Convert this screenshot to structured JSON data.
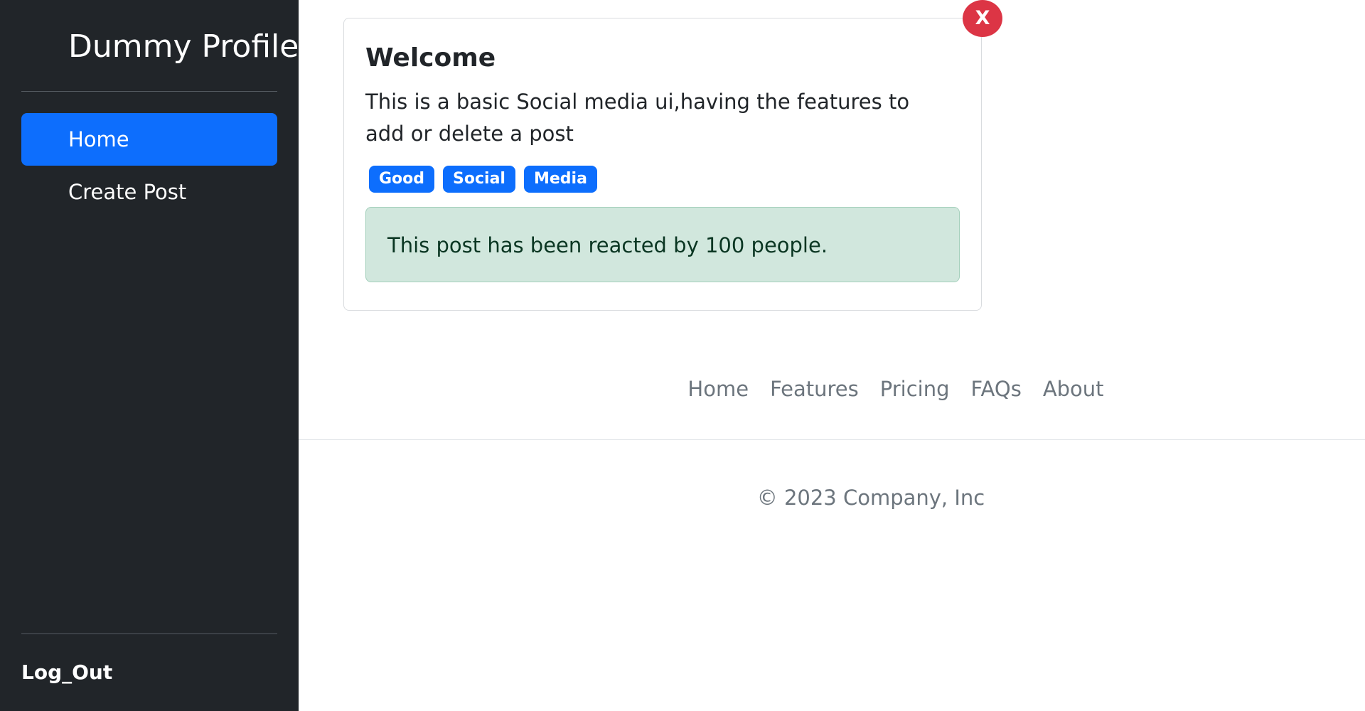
{
  "sidebar": {
    "brand": "Dummy Profile",
    "items": [
      {
        "label": "Home",
        "active": true
      },
      {
        "label": "Create Post",
        "active": false
      }
    ],
    "logout_label": "Log_Out"
  },
  "post": {
    "close_label": "X",
    "title": "Welcome",
    "body": "This is a basic Social media ui,having the features to add or delete a post",
    "tags": [
      "Good",
      "Social",
      "Media"
    ],
    "reactions_text": "This post has been reacted by 100 people."
  },
  "footer": {
    "links": [
      "Home",
      "Features",
      "Pricing",
      "FAQs",
      "About"
    ],
    "copyright": "© 2023 Company, Inc"
  },
  "colors": {
    "sidebar_bg": "#212529",
    "accent": "#0d6efd",
    "danger": "#dc3545",
    "success_bg": "#d1e7dd"
  }
}
